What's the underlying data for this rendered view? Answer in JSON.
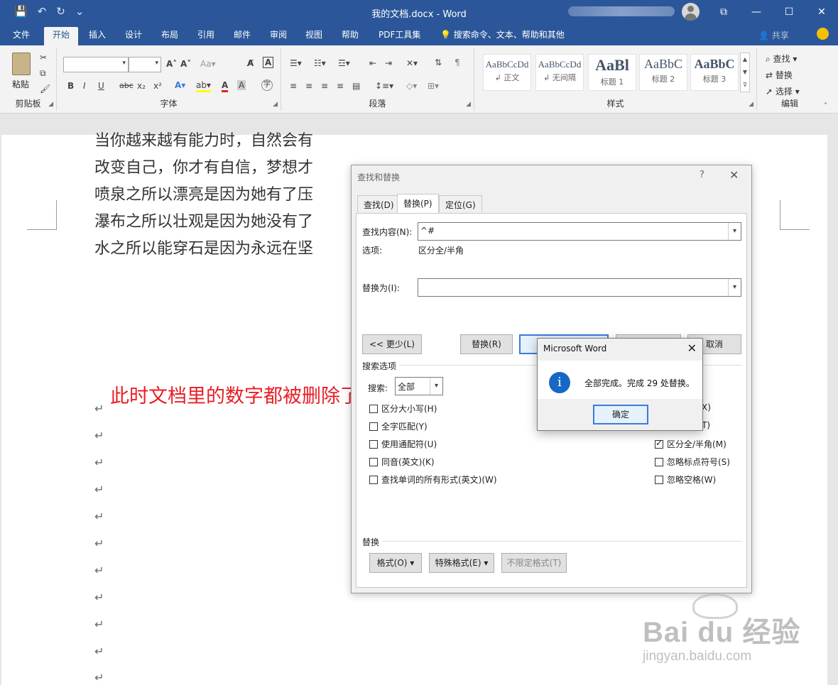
{
  "window": {
    "title": "我的文档.docx  -  Word",
    "controls": [
      "⧉",
      "—",
      "☐",
      "✕"
    ]
  },
  "qat": [
    "💾",
    "↶",
    "↻",
    "⌄"
  ],
  "menu_tabs": [
    "文件",
    "开始",
    "插入",
    "设计",
    "布局",
    "引用",
    "邮件",
    "审阅",
    "视图",
    "帮助",
    "PDF工具集"
  ],
  "active_tab": "开始",
  "tell_me": "搜索命令、文本、帮助和其他",
  "share": "共享",
  "ribbon": {
    "clipboard": {
      "paste": "粘贴",
      "label": "剪贴板"
    },
    "font": {
      "label": "字体",
      "buttons": [
        "B",
        "I",
        "U",
        "abc",
        "x₂",
        "x²"
      ]
    },
    "paragraph": {
      "label": "段落"
    },
    "styles": {
      "label": "样式",
      "items": [
        {
          "sample": "AaBbCcDd",
          "name": "↲ 正文"
        },
        {
          "sample": "AaBbCcDd",
          "name": "↲ 无间隔"
        },
        {
          "sample": "AaBl",
          "name": "标题 1"
        },
        {
          "sample": "AaBbC",
          "name": "标题 2"
        },
        {
          "sample": "AaBbC",
          "name": "标题 3"
        }
      ]
    },
    "editing": {
      "label": "编辑",
      "find": "查找",
      "replace": "替换",
      "select": "选择"
    }
  },
  "document": {
    "lines": [
      "当你越来越有能力时，自然会有",
      "改变自己，你才有自信，梦想才",
      "喷泉之所以漂亮是因为她有了压",
      "瀑布之所以壮观是因为她没有了",
      "水之所以能穿石是因为永远在坚"
    ],
    "para_mark": "↵",
    "annotation": "此时文档里的数字都被删除了"
  },
  "find_replace": {
    "title": "查找和替换",
    "help": "?",
    "close": "✕",
    "tabs": [
      "查找(D)",
      "替换(P)",
      "定位(G)"
    ],
    "find_label": "查找内容(N):",
    "find_value": "^#",
    "options_label": "选项:",
    "options_value": "区分全/半角",
    "replace_label": "替换为(I):",
    "replace_value": "",
    "buttons": {
      "less": "<< 更少(L)",
      "replace": "替换(R)",
      "replace_all": "",
      "find_next": "",
      "cancel": "取消"
    },
    "search_options_label": "搜索选项",
    "search_label": "搜索:",
    "search_value": "全部",
    "checkboxes_left": [
      {
        "label": "区分大小写(H)",
        "checked": false
      },
      {
        "label": "全字匹配(Y)",
        "checked": false
      },
      {
        "label": "使用通配符(U)",
        "checked": false
      },
      {
        "label": "同音(英文)(K)",
        "checked": false
      },
      {
        "label": "查找单词的所有形式(英文)(W)",
        "checked": false
      }
    ],
    "checkboxes_right": [
      {
        "label": "X)",
        "checked": false
      },
      {
        "label": "T)",
        "checked": false
      },
      {
        "label": "区分全/半角(M)",
        "checked": true
      },
      {
        "label": "忽略标点符号(S)",
        "checked": false
      },
      {
        "label": "忽略空格(W)",
        "checked": false
      }
    ],
    "replace_section_label": "替换",
    "format_button": "格式(O) ▾",
    "special_button": "特殊格式(E) ▾",
    "no_format_button": "不限定格式(T)"
  },
  "message_box": {
    "title": "Microsoft Word",
    "close": "✕",
    "icon": "i",
    "text": "全部完成。完成 29 处替换。",
    "ok": "确定"
  },
  "watermark": {
    "line1": "Bai du 经验",
    "line2": "jingyan.baidu.com"
  },
  "colors": {
    "accent": "#2b579a",
    "annotation": "#e81e25",
    "info": "#1668c4"
  }
}
